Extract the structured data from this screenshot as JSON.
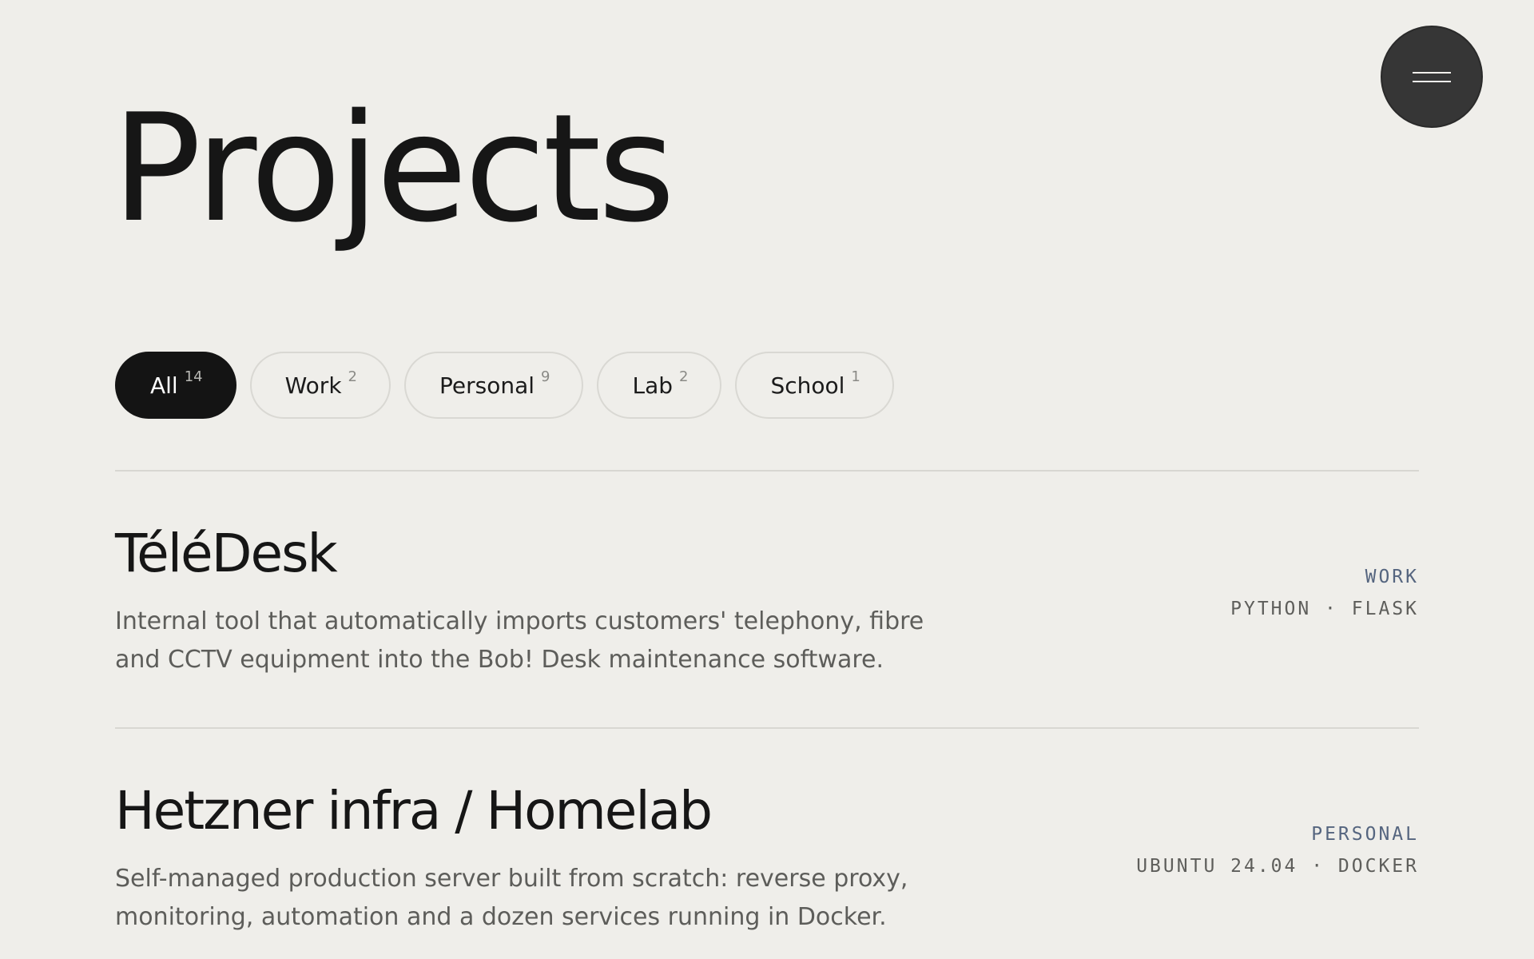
{
  "header": {
    "title": "Projects"
  },
  "filters": [
    {
      "label": "All",
      "count": "14",
      "active": true
    },
    {
      "label": "Work",
      "count": "2",
      "active": false
    },
    {
      "label": "Personal",
      "count": "9",
      "active": false
    },
    {
      "label": "Lab",
      "count": "2",
      "active": false
    },
    {
      "label": "School",
      "count": "1",
      "active": false
    }
  ],
  "projects": [
    {
      "title": "TéléDesk",
      "description": "Internal tool that automatically imports customers' telephony, fibre and CCTV equipment into the Bob! Desk maintenance software.",
      "category": "WORK",
      "stack": "PYTHON · FLASK"
    },
    {
      "title": "Hetzner infra / Homelab",
      "description": "Self-managed production server built from scratch: reverse proxy, monitoring, automation and a dozen services running in Docker.",
      "category": "PERSONAL",
      "stack": "UBUNTU 24.04 · DOCKER"
    }
  ],
  "icons": {
    "menu": "hamburger-icon"
  },
  "colors": {
    "background": "#efeeea",
    "text": "#161616",
    "active_chip": "#141414",
    "menu_button": "#363636",
    "category_accent": "#55657f",
    "muted_text": "#5d5d5a"
  }
}
